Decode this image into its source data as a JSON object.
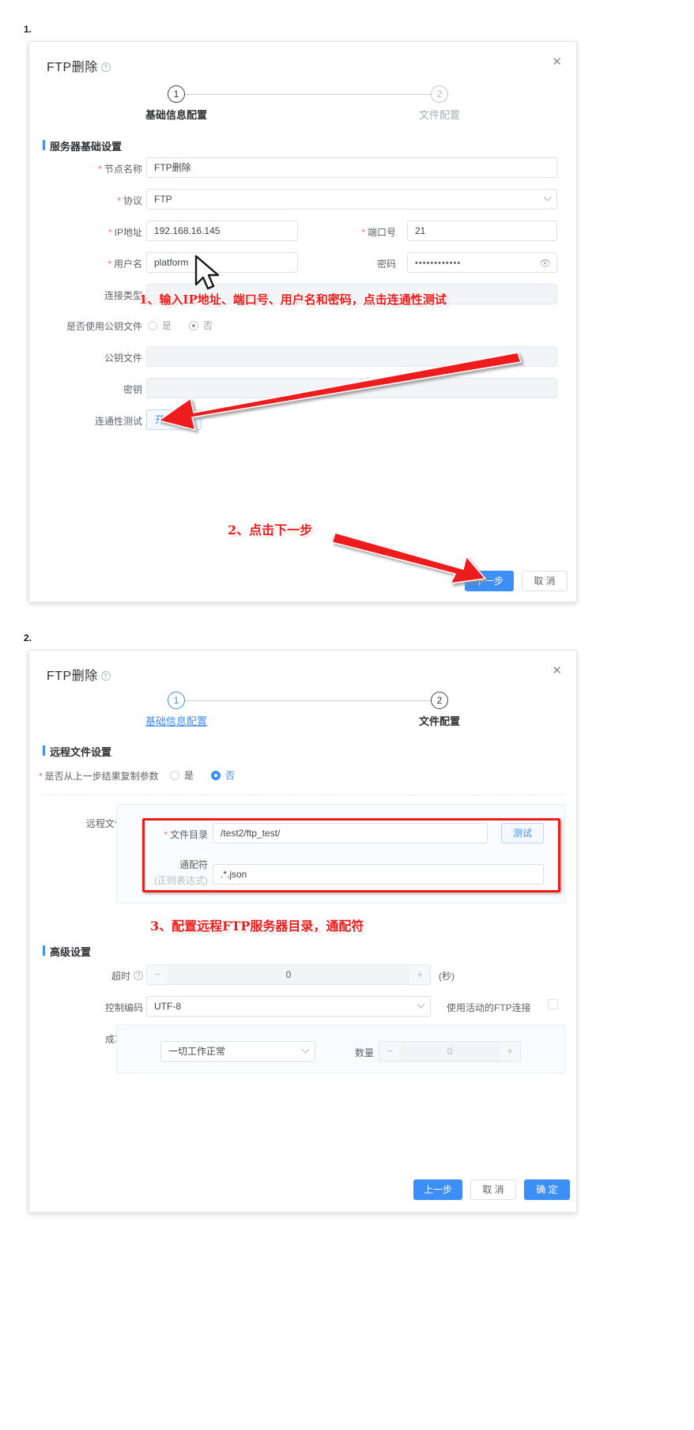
{
  "figure": {
    "step1_number": "1.",
    "step2_number": "2."
  },
  "dialog1": {
    "title": "FTP删除",
    "help_icon": "?",
    "close_icon": "✕",
    "stepper": {
      "step1_num": "1",
      "step1_label": "基础信息配置",
      "step2_num": "2",
      "step2_label": "文件配置"
    },
    "section_title": "服务器基础设置",
    "fields": {
      "node_name_label": "节点名称",
      "node_name_value": "FTP删除",
      "protocol_label": "协议",
      "protocol_value": "FTP",
      "ip_label": "IP地址",
      "ip_value": "192.168.16.145",
      "port_label": "端口号",
      "port_value": "21",
      "username_label": "用户名",
      "username_value": "platform",
      "password_label": "密码",
      "password_value": "••••••••••••",
      "conn_type_label": "连接类型",
      "conn_type_value": "",
      "use_pubkey_label": "是否使用公钥文件",
      "use_pubkey_yes": "是",
      "use_pubkey_no": "否",
      "pubkey_file_label": "公钥文件",
      "pubkey_file_value": "",
      "secret_label": "密钥",
      "secret_value": "",
      "conn_test_label": "连通性测试",
      "conn_test_button": "开始测试"
    },
    "footer": {
      "next_label": "下一步",
      "cancel_label": "取 消"
    }
  },
  "dialog2": {
    "title": "FTP删除",
    "help_icon": "?",
    "close_icon": "✕",
    "stepper": {
      "step1_num": "1",
      "step1_label": "基础信息配置",
      "step2_num": "2",
      "step2_label": "文件配置"
    },
    "remote_section_title": "远程文件设置",
    "copy_params_label": "是否从上一步结果复制参数",
    "copy_params_yes": "是",
    "copy_params_no": "否",
    "remote_group_label": "远程文件设置",
    "file_dir_label": "文件目录",
    "file_dir_value": "/test2/ftp_test/",
    "test_button": "测试",
    "wildcard_label": "通配符",
    "wildcard_sub_label": "(正则表达式)",
    "wildcard_value": ".*.json",
    "advanced_section_title": "高级设置",
    "timeout_label": "超时",
    "timeout_help_icon": "?",
    "timeout_minus": "−",
    "timeout_value": "0",
    "timeout_plus": "+",
    "timeout_unit": "(秒)",
    "encoding_label": "控制编码",
    "encoding_value": "UTF-8",
    "active_ftp_label": "使用活动的FTP连接",
    "success_cond_label": "成功条件",
    "success_cond_value": "一切工作正常",
    "quantity_label": "数量",
    "quantity_minus": "−",
    "quantity_value": "0",
    "quantity_plus": "+",
    "footer": {
      "prev_label": "上一步",
      "cancel_label": "取 消",
      "confirm_label": "确 定"
    }
  },
  "annotations": {
    "note1": "1、输入IP地址、端口号、用户名和密码，点击连通性测试",
    "note2": "2、点击下一步",
    "note3": "3、配置远程FTP服务器目录，通配符"
  },
  "colors": {
    "accent": "#3d8ef5",
    "annotation": "#ee1b1b",
    "required": "#f56c6c",
    "text": "#303133",
    "label": "#606266"
  }
}
